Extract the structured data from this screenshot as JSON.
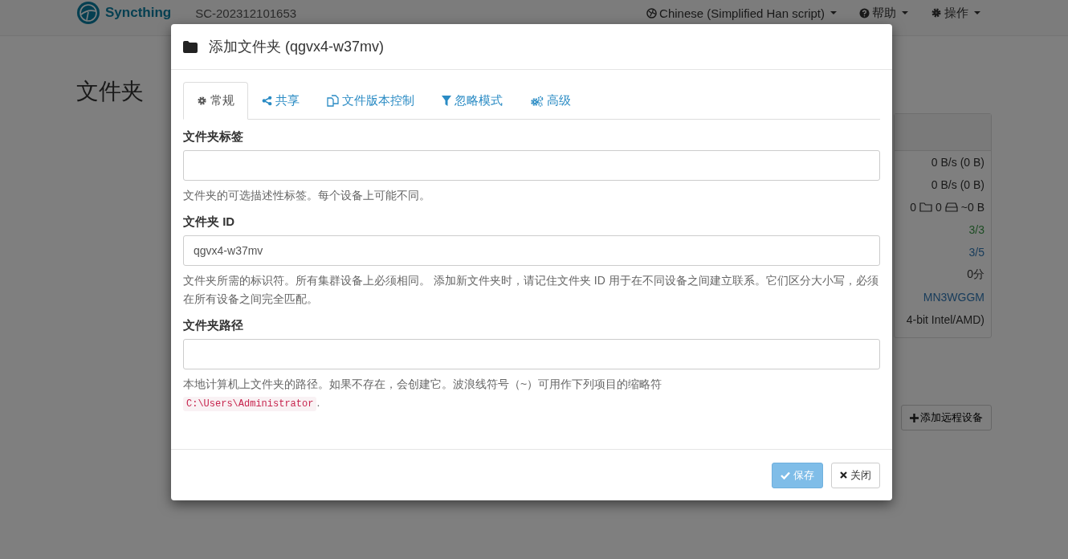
{
  "navbar": {
    "brand": "Syncthing",
    "device_name": "SC-202312101653",
    "menus": [
      {
        "kind": "language",
        "label": "Chinese (Simplified Han script)"
      },
      {
        "kind": "help",
        "label": "帮助"
      },
      {
        "kind": "actions",
        "label": "操作"
      }
    ]
  },
  "page": {
    "heading": "文件夹",
    "panel_rows": [
      {
        "kind": "plain",
        "value": "0 B/s (0 B)"
      },
      {
        "kind": "plain",
        "value": "0 B/s (0 B)"
      },
      {
        "kind": "counts",
        "files": "0",
        "folders": "0",
        "size": "~0 B"
      },
      {
        "kind": "good",
        "value": "3/3"
      },
      {
        "kind": "link",
        "value": "3/5"
      },
      {
        "kind": "plain",
        "value": "0分"
      },
      {
        "kind": "link",
        "value": "MN3WGGM"
      },
      {
        "kind": "plain",
        "value": "4-bit Intel/AMD)"
      }
    ],
    "add_device_button": "添加远程设备"
  },
  "dialog": {
    "title": "添加文件夹 (qgvx4-w37mv)",
    "tabs": [
      {
        "kind": "general",
        "label": "常规",
        "selected": true
      },
      {
        "kind": "sharing",
        "label": "共享",
        "selected": false
      },
      {
        "kind": "versioning",
        "label": "文件版本控制",
        "selected": false
      },
      {
        "kind": "ignore",
        "label": "忽略模式",
        "selected": false
      },
      {
        "kind": "advanced",
        "label": "高级",
        "selected": false
      }
    ],
    "fields": [
      {
        "label": "文件夹标签",
        "help": "文件夹的可选描述性标签。每个设备上可能不同。"
      },
      {
        "label": "文件夹 ID",
        "value": "qgvx4-w37mv",
        "help": "文件夹所需的标识符。所有集群设备上必须相同。 添加新文件夹时，请记住文件夹 ID 用于在不同设备之间建立联系。它们区分大小写，必须在所有设备之间完全匹配。"
      },
      {
        "label": "文件夹路径",
        "help": "本地计算机上文件夹的路径。如果不存在，会创建它。波浪线符号（~）可用作下列项目的缩略符",
        "code": "C:\\Users\\Administrator",
        "after_code": "."
      }
    ],
    "save_button": "保存",
    "close_button": "关闭"
  }
}
